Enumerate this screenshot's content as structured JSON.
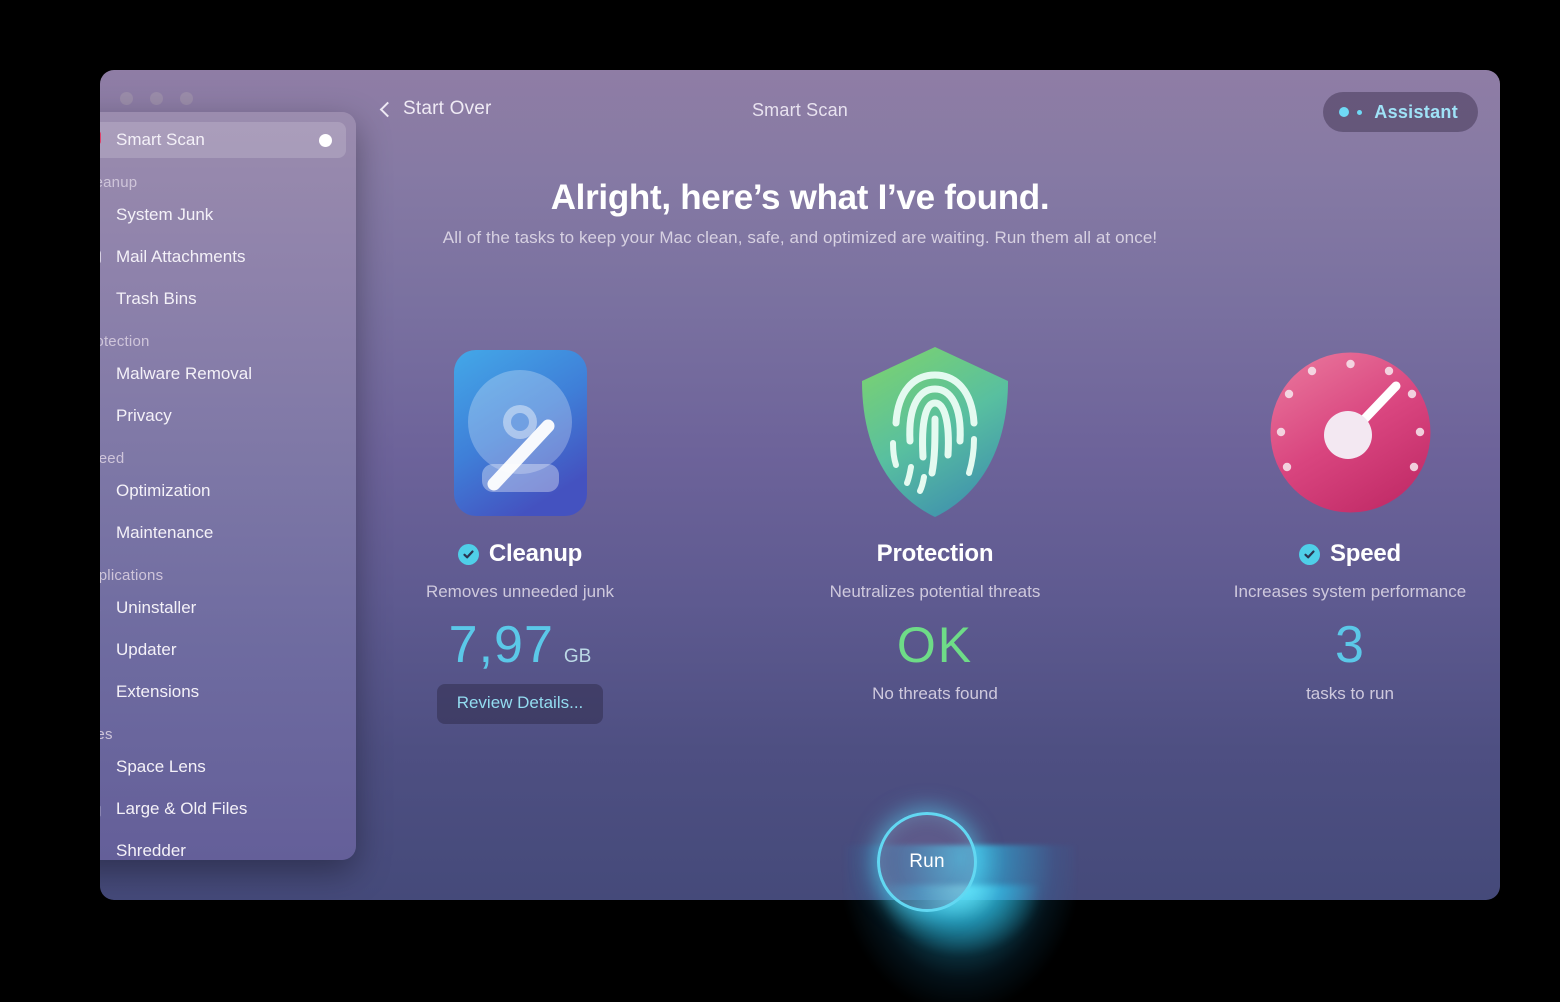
{
  "window": {
    "title": "Smart Scan",
    "back_label": "Start Over",
    "assistant_label": "Assistant",
    "accent_cyan": "#5bc8e8",
    "accent_green": "#6edc87"
  },
  "hero": {
    "headline": "Alright, here’s what I’ve found.",
    "subhead": "All of the tasks to keep your Mac clean, safe, and optimized are waiting. Run them all at once!"
  },
  "cards": [
    {
      "id": "cleanup",
      "title": "Cleanup",
      "checked": true,
      "description": "Removes unneeded junk",
      "value": "7,97",
      "unit": "GB",
      "sub": "",
      "button": "Review Details...",
      "icon": "hard-drive-icon"
    },
    {
      "id": "protection",
      "title": "Protection",
      "checked": false,
      "description": "Neutralizes potential threats",
      "value": "OK",
      "unit": "",
      "sub": "No threats found",
      "button": "",
      "icon": "shield-fingerprint-icon"
    },
    {
      "id": "speed",
      "title": "Speed",
      "checked": true,
      "description": "Increases system performance",
      "value": "3",
      "unit": "",
      "sub": "tasks to run",
      "button": "",
      "icon": "speedometer-icon"
    }
  ],
  "run_button": {
    "label": "Run"
  },
  "sidebar": {
    "top_item": {
      "label": "Smart Scan",
      "icon": "monitor-scan-icon",
      "active": true,
      "indicator": true
    },
    "groups": [
      {
        "label": "Cleanup",
        "items": [
          {
            "label": "System Junk",
            "icon": "broom-icon"
          },
          {
            "label": "Mail Attachments",
            "icon": "envelope-icon"
          },
          {
            "label": "Trash Bins",
            "icon": "trash-bin-icon"
          }
        ]
      },
      {
        "label": "Protection",
        "items": [
          {
            "label": "Malware Removal",
            "icon": "biohazard-icon"
          },
          {
            "label": "Privacy",
            "icon": "hand-icon"
          }
        ]
      },
      {
        "label": "Speed",
        "items": [
          {
            "label": "Optimization",
            "icon": "sliders-icon"
          },
          {
            "label": "Maintenance",
            "icon": "wrench-icon"
          }
        ]
      },
      {
        "label": "Applications",
        "items": [
          {
            "label": "Uninstaller",
            "icon": "app-stack-icon"
          },
          {
            "label": "Updater",
            "icon": "refresh-arrow-icon"
          },
          {
            "label": "Extensions",
            "icon": "puzzle-icon"
          }
        ]
      },
      {
        "label": "Files",
        "items": [
          {
            "label": "Space Lens",
            "icon": "planet-icon"
          },
          {
            "label": "Large & Old Files",
            "icon": "folder-icon"
          },
          {
            "label": "Shredder",
            "icon": "shredder-icon"
          }
        ]
      }
    ]
  }
}
